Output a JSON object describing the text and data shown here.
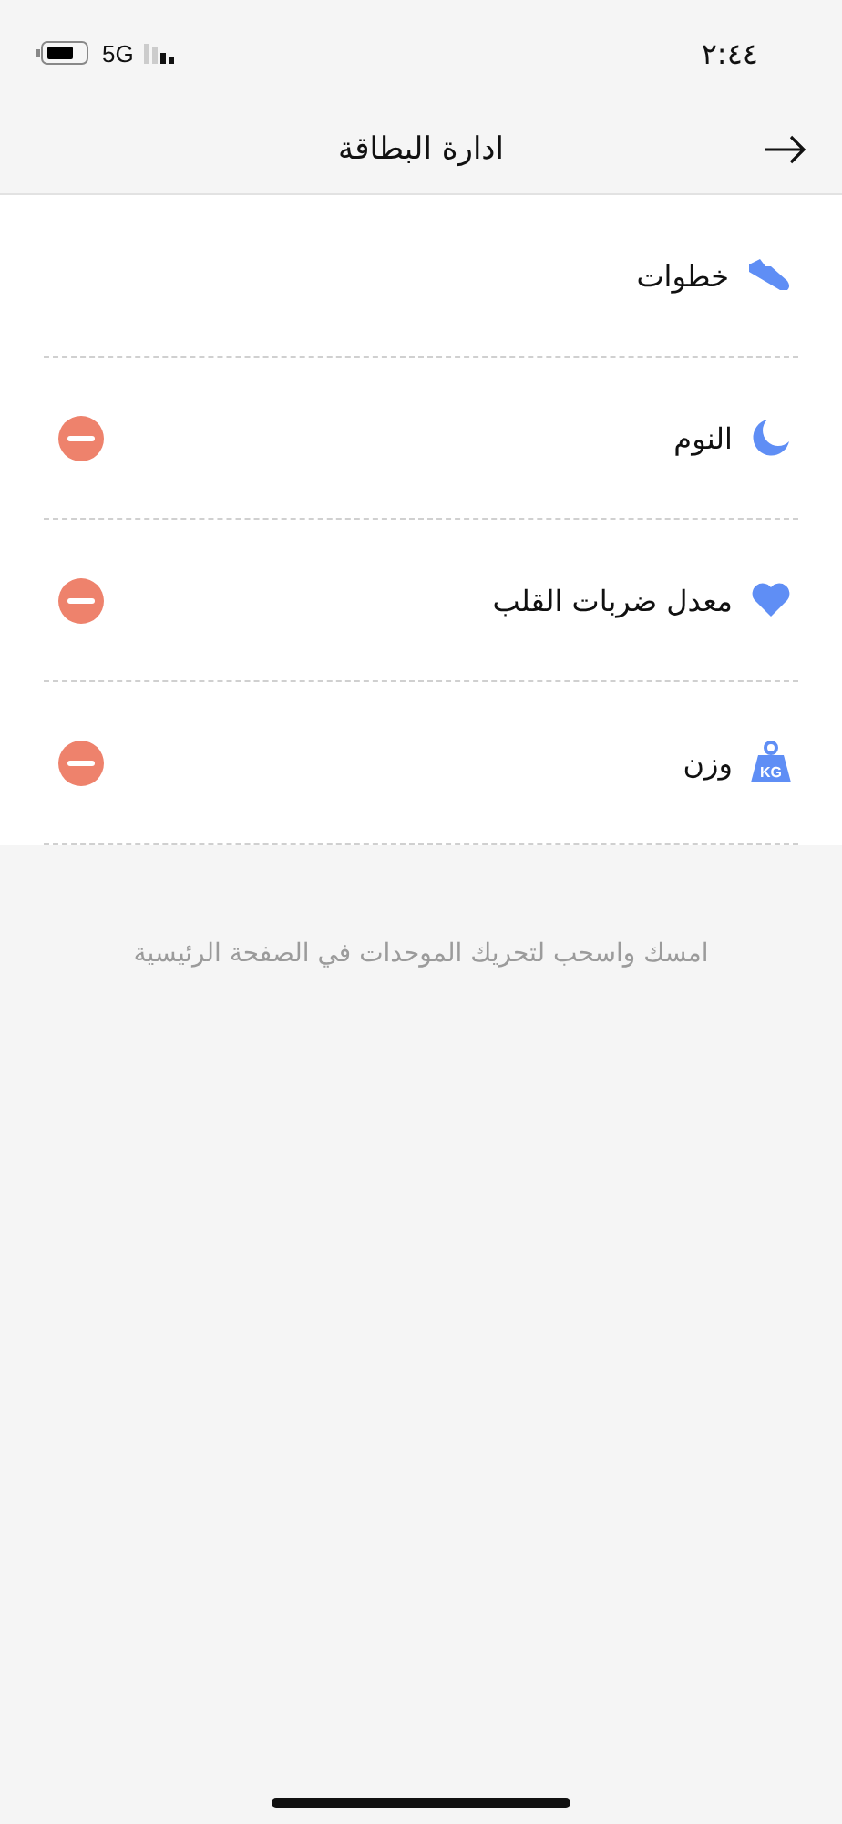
{
  "status_bar": {
    "time": "٢:٤٤",
    "network": "5G"
  },
  "header": {
    "title": "ادارة البطاقة"
  },
  "cards": [
    {
      "label": "خطوات",
      "kind": "shoe",
      "removable": false
    },
    {
      "label": "النوم",
      "kind": "moon",
      "removable": true
    },
    {
      "label": "معدل ضربات القلب",
      "kind": "heart",
      "removable": true
    },
    {
      "label": "وزن",
      "kind": "weight",
      "icon_text": "KG",
      "removable": true
    }
  ],
  "hint": "امسك واسحب لتحريك الموحدات في الصفحة الرئيسية"
}
